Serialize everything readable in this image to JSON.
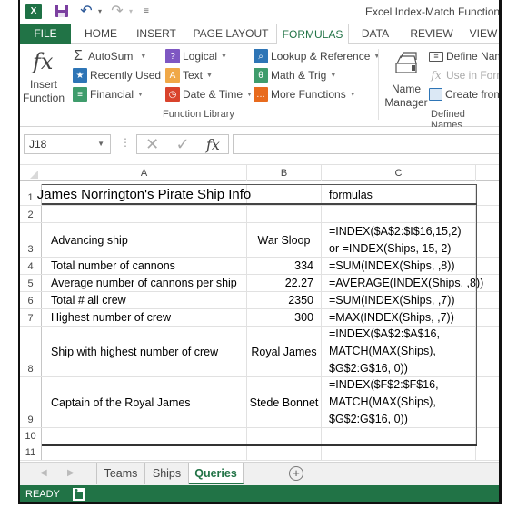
{
  "window": {
    "title": "Excel Index-Match Functions.x",
    "quick_access": {
      "app_icon": "excel-icon",
      "save_icon": "save-icon",
      "undo_icon": "undo-icon",
      "redo_icon": "redo-icon",
      "customize_icon": "customize-qat-icon"
    }
  },
  "ribbon_tabs": [
    {
      "label": "FILE"
    },
    {
      "label": "HOME"
    },
    {
      "label": "INSERT"
    },
    {
      "label": "PAGE LAYOUT"
    },
    {
      "label": "FORMULAS",
      "active": true
    },
    {
      "label": "DATA"
    },
    {
      "label": "REVIEW"
    },
    {
      "label": "VIEW"
    }
  ],
  "ribbon": {
    "insert_function": {
      "line1": "Insert",
      "line2": "Function",
      "icon": "fx"
    },
    "function_library": {
      "label": "Function Library",
      "items": [
        {
          "label": "AutoSum",
          "icon": "Σ",
          "color": "#444444"
        },
        {
          "label": "Recently Used",
          "icon": "★",
          "color": "#2e75b6"
        },
        {
          "label": "Financial",
          "icon": "≡",
          "color": "#3f9c6c"
        },
        {
          "label": "Logical",
          "icon": "?",
          "color": "#7e57c2"
        },
        {
          "label": "Text",
          "icon": "A",
          "color": "#f0a848"
        },
        {
          "label": "Date & Time",
          "icon": "◷",
          "color": "#d9432c"
        },
        {
          "label": "Lookup & Reference",
          "icon": "⌕",
          "color": "#2e75b6"
        },
        {
          "label": "Math & Trig",
          "icon": "θ",
          "color": "#3f9c6c"
        },
        {
          "label": "More Functions",
          "icon": "…",
          "color": "#e86b1e"
        }
      ]
    },
    "defined_names": {
      "label": "Defined Names",
      "name_manager": {
        "line1": "Name",
        "line2": "Manager"
      },
      "items": [
        {
          "label": "Define Name"
        },
        {
          "label": "Use in Formula",
          "disabled": true
        },
        {
          "label": "Create from Selection"
        }
      ]
    }
  },
  "formula_bar": {
    "name_box": "J18",
    "cancel_icon": "✕",
    "enter_icon": "✓",
    "fx_label": "fx",
    "value": ""
  },
  "columns": [
    "A",
    "B",
    "C"
  ],
  "rows": [
    {
      "num": "1",
      "a": "James Norrington's Pirate Ship Info",
      "b": "",
      "c": [
        "formulas"
      ]
    },
    {
      "num": "2",
      "a": "",
      "b": "",
      "c": [
        ""
      ]
    },
    {
      "num": "3",
      "a": "Advancing ship",
      "b": "War Sloop",
      "c": [
        "=INDEX($A$2:$I$16,15,2)",
        "or =INDEX(Ships, 15, 2)"
      ]
    },
    {
      "num": "4",
      "a": "Total number of cannons",
      "b": "334",
      "c": [
        "=SUM(INDEX(Ships, ,8))"
      ]
    },
    {
      "num": "5",
      "a": "Average number of cannons per ship",
      "b": "22.27",
      "c": [
        "=AVERAGE(INDEX(Ships, ,8))"
      ]
    },
    {
      "num": "6",
      "a": "Total # all crew",
      "b": "2350",
      "c": [
        "=SUM(INDEX(Ships, ,7))"
      ]
    },
    {
      "num": "7",
      "a": "Highest number of crew",
      "b": "300",
      "c": [
        "=MAX(INDEX(Ships, ,7))"
      ]
    },
    {
      "num": "8",
      "a": "Ship with highest number of crew",
      "b": "Royal James",
      "c": [
        "=INDEX($A$2:$A$16,",
        "MATCH(MAX(Ships),",
        "$G$2:G$16, 0))"
      ]
    },
    {
      "num": "9",
      "a": "Captain of the Royal James",
      "b": "Stede Bonnet",
      "c": [
        "=INDEX($F$2:$F$16,",
        "MATCH(MAX(Ships),",
        "$G$2:G$16, 0))"
      ]
    },
    {
      "num": "10",
      "a": "",
      "b": "",
      "c": [
        ""
      ]
    },
    {
      "num": "11",
      "a": "",
      "b": "",
      "c": [
        ""
      ]
    }
  ],
  "sheet_tabs": [
    {
      "label": "Teams"
    },
    {
      "label": "Ships"
    },
    {
      "label": "Queries",
      "active": true
    }
  ],
  "status": {
    "text": "READY"
  },
  "colors": {
    "accent": "#217346"
  }
}
